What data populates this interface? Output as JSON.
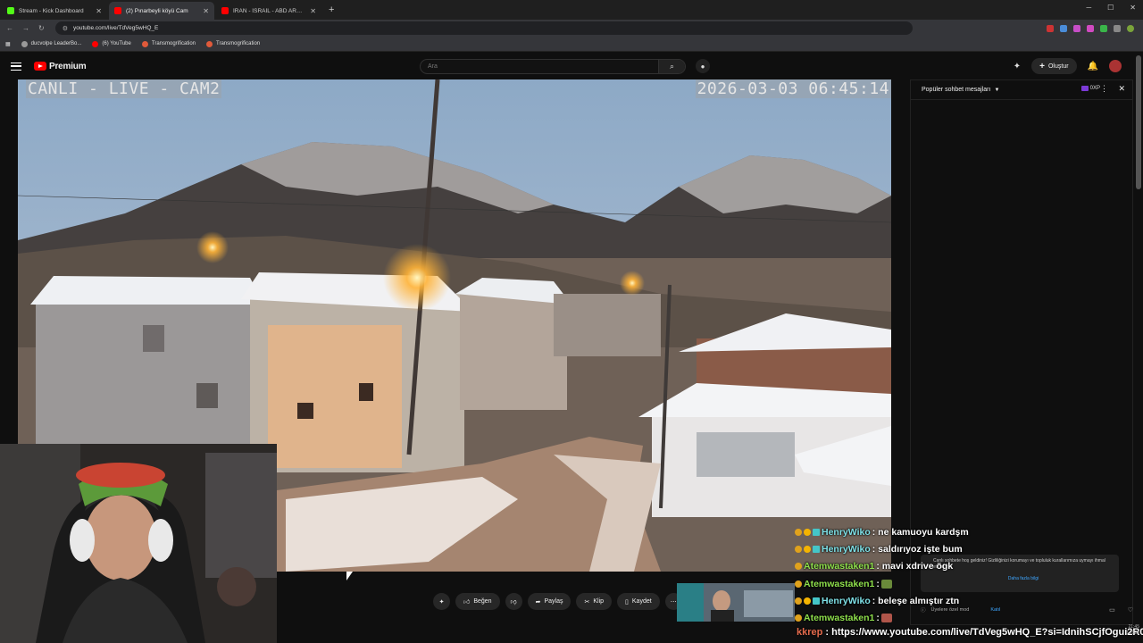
{
  "browser": {
    "tabs": [
      {
        "title": "Stream - Kick Dashboard",
        "active": false,
        "color": "#53fc18"
      },
      {
        "title": "(2) Pınarbeyli köyü Cam",
        "active": true,
        "color": "#ff0000"
      },
      {
        "title": "İRAN - İSRAİL - ABD ARASINDA",
        "active": false,
        "color": "#ff0000"
      }
    ],
    "new_tab": "+",
    "url": "youtube.com/live/TdVeg5wHQ_E",
    "bookmarks": [
      {
        "label": "ducvolpe LeaderBo...",
        "color": "#999"
      },
      {
        "label": "(6) YouTube",
        "color": "#ff0000"
      },
      {
        "label": "Transmogrification",
        "color": "#e05a3a"
      },
      {
        "label": "Transmogrification",
        "color": "#e05a3a"
      }
    ]
  },
  "youtube": {
    "logo_text": "Premium",
    "search_placeholder": "Ara",
    "create_label": "Oluştur"
  },
  "video": {
    "osd_left": "CANLI - LIVE - CAM2",
    "osd_right": "2026-03-03 06:45:14",
    "counter": "96"
  },
  "actions": {
    "like": "Beğen",
    "share": "Paylaş",
    "clip": "Klip",
    "save": "Kaydet"
  },
  "chat_panel": {
    "title": "Popüler sohbet mesajları",
    "xp": "0XP",
    "welcome_text": "Canlı sohbete hoş geldiniz! Gizliliğinizi korumayı ve topluluk kurallarımıza uymayı ihmal etmeyin.",
    "more_info": "Daha fazla bilgi",
    "members_mode": "Üyelere özel mod",
    "join": "Katıl"
  },
  "overlay_chat": [
    {
      "user": "HenryWiko",
      "text": ": ne kamuoyu kardşm",
      "user_color": "#7ee0e6",
      "badges": 3
    },
    {
      "user": "HenryWiko",
      "text": ": saldırıyoz işte bum",
      "user_color": "#7ee0e6",
      "badges": 3
    },
    {
      "user": "Atemwastaken1",
      "text": ": mavi xdrive ögk",
      "user_color": "#8fe04c",
      "badges": 1
    },
    {
      "user": "Atemwastaken1",
      "text": ":",
      "user_color": "#8fe04c",
      "badges": 1
    },
    {
      "user": "HenryWiko",
      "text": ": beleşe almıştır ztn",
      "user_color": "#7ee0e6",
      "badges": 3
    },
    {
      "user": "Atemwastaken1",
      "text": ":",
      "user_color": "#8fe04c",
      "badges": 1
    }
  ],
  "link_message": {
    "user": "kkrep",
    "text": ": https://www.youtube.com/live/TdVeg5wHQ_E?si=IdnihSCjfOgui2R0"
  },
  "clock": {
    "time": "21:45",
    "date": "3.2026"
  }
}
